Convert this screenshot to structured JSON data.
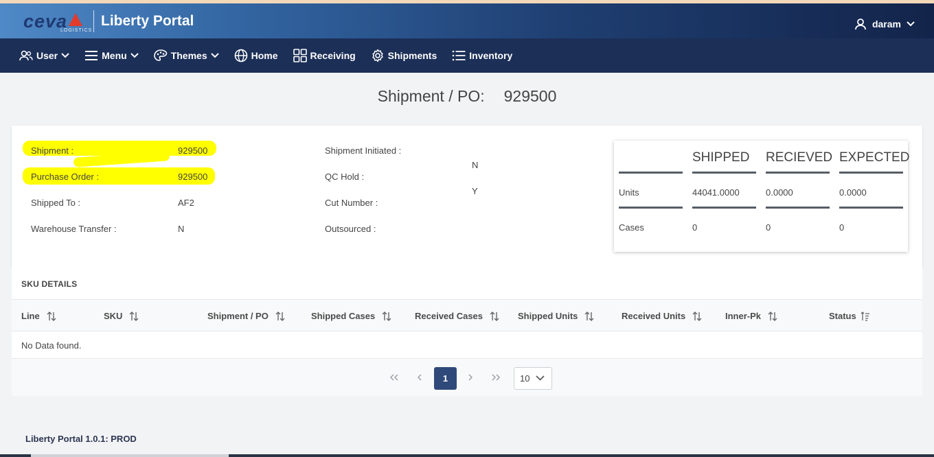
{
  "header": {
    "logo": "ceva",
    "logo_sub": "LOGISTICS",
    "app_title": "Liberty Portal",
    "user_name": "daram",
    "user_icon": "user-icon"
  },
  "nav": {
    "items": [
      {
        "label": "User",
        "icon": "users-icon",
        "dropdown": true
      },
      {
        "label": "Menu",
        "icon": "hamburger-icon",
        "dropdown": true
      },
      {
        "label": "Themes",
        "icon": "palette-icon",
        "dropdown": true
      },
      {
        "label": "Home",
        "icon": "globe-icon",
        "dropdown": false
      },
      {
        "label": "Receiving",
        "icon": "grid-icon",
        "dropdown": false
      },
      {
        "label": "Shipments",
        "icon": "gear-icon",
        "dropdown": false
      },
      {
        "label": "Inventory",
        "icon": "list-icon",
        "dropdown": false
      }
    ]
  },
  "page": {
    "heading_label": "Shipment / PO:",
    "heading_value": "929500"
  },
  "details": {
    "left": [
      {
        "label": "Shipment :",
        "value": "929500"
      },
      {
        "label": "Purchase Order :",
        "value": "929500"
      },
      {
        "label": "Shipped To :",
        "value": "AF2"
      },
      {
        "label": "Warehouse Transfer :",
        "value": "N"
      }
    ],
    "middle": [
      {
        "label": "Shipment Initiated :"
      },
      {
        "label": "QC Hold :"
      },
      {
        "label": "Cut Number :"
      },
      {
        "label": "Outsourced :"
      }
    ],
    "middle_values": [
      "N",
      "Y"
    ],
    "highlight_color": "#ffff00"
  },
  "summary": {
    "headers": [
      "SHIPPED",
      "RECIEVED",
      "EXPECTED"
    ],
    "rows": [
      {
        "label": "Units",
        "values": [
          "44041.0000",
          "0.0000",
          "0.0000"
        ]
      },
      {
        "label": "Cases",
        "values": [
          "0",
          "0",
          "0"
        ]
      }
    ]
  },
  "sku": {
    "title": "SKU DETAILS",
    "columns": [
      "Line",
      "SKU",
      "Shipment / PO",
      "Shipped Cases",
      "Received Cases",
      "Shipped Units",
      "Received Units",
      "Inner-Pk",
      "Status"
    ],
    "empty_message": "No Data found.",
    "pagination": {
      "current_page": "1",
      "page_size": "10"
    }
  },
  "footer": {
    "text": "Liberty Portal 1.0.1: PROD"
  },
  "colors": {
    "nav_bg": "#1c2f57",
    "accent": "#2f4a7a",
    "brand_red": "#e23b2d"
  }
}
